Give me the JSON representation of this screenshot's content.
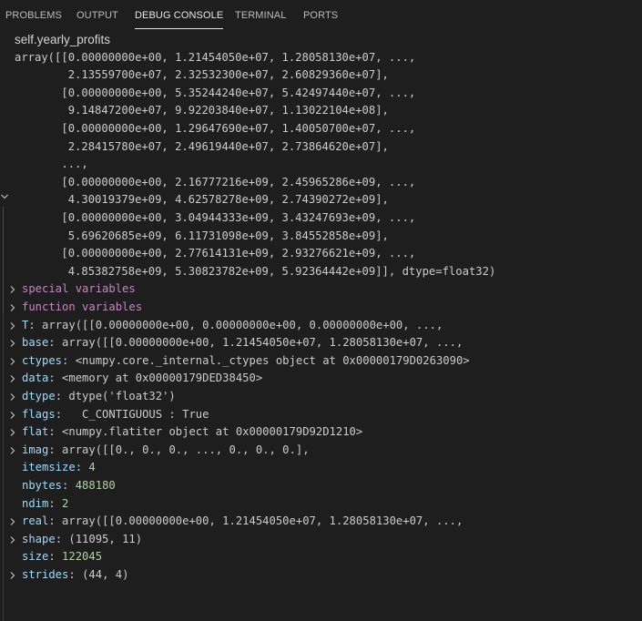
{
  "tabs": [
    {
      "label": "PROBLEMS",
      "active": false
    },
    {
      "label": "OUTPUT",
      "active": false
    },
    {
      "label": "DEBUG CONSOLE",
      "active": true
    },
    {
      "label": "TERMINAL",
      "active": false
    },
    {
      "label": "PORTS",
      "active": false
    }
  ],
  "console": {
    "expression": "self.yearly_profits",
    "array_lines": [
      "array([[0.00000000e+00, 1.21454050e+07, 1.28058130e+07, ...,",
      "        2.13559700e+07, 2.32532300e+07, 2.60829360e+07],",
      "       [0.00000000e+00, 5.35244240e+07, 5.42497440e+07, ...,",
      "        9.14847200e+07, 9.92203840e+07, 1.13022104e+08],",
      "       [0.00000000e+00, 1.29647690e+07, 1.40050700e+07, ...,",
      "        2.28415780e+07, 2.49619440e+07, 2.73864620e+07],",
      "       ...,",
      "       [0.00000000e+00, 2.16777216e+09, 2.45965286e+09, ...,",
      "        4.30019379e+09, 4.62578278e+09, 2.74390272e+09],",
      "       [0.00000000e+00, 3.04944333e+09, 3.43247693e+09, ...,",
      "        5.69620685e+09, 6.11731098e+09, 3.84552858e+09],",
      "       [0.00000000e+00, 2.77614131e+09, 2.93276621e+09, ...,",
      "        4.85382758e+09, 5.30823782e+09, 5.92364442e+09]], dtype=float32)"
    ],
    "properties": [
      {
        "key": "special variables",
        "value": "",
        "expandable": true,
        "group": true
      },
      {
        "key": "function variables",
        "value": "",
        "expandable": true,
        "group": true
      },
      {
        "key": "T",
        "value": "array([[0.00000000e+00, 0.00000000e+00, 0.00000000e+00, ...,",
        "expandable": true
      },
      {
        "key": "base",
        "value": "array([[0.00000000e+00, 1.21454050e+07, 1.28058130e+07, ...,",
        "expandable": true
      },
      {
        "key": "ctypes",
        "value": "<numpy.core._internal._ctypes object at 0x00000179D0263090>",
        "expandable": true
      },
      {
        "key": "data",
        "value": "<memory at 0x00000179DED38450>",
        "expandable": true
      },
      {
        "key": "dtype",
        "value": "dtype('float32')",
        "expandable": true
      },
      {
        "key": "flags",
        "value": "  C_CONTIGUOUS : True",
        "expandable": true
      },
      {
        "key": "flat",
        "value": "<numpy.flatiter object at 0x00000179D92D1210>",
        "expandable": true
      },
      {
        "key": "imag",
        "value": "array([[0., 0., 0., ..., 0., 0., 0.],",
        "expandable": true
      },
      {
        "key": "itemsize",
        "value": "4",
        "expandable": false,
        "numeric": true
      },
      {
        "key": "nbytes",
        "value": "488180",
        "expandable": false,
        "numeric": true
      },
      {
        "key": "ndim",
        "value": "2",
        "expandable": false,
        "numeric": true
      },
      {
        "key": "real",
        "value": "array([[0.00000000e+00, 1.21454050e+07, 1.28058130e+07, ...,",
        "expandable": true
      },
      {
        "key": "shape",
        "value": "(11095, 11)",
        "expandable": true
      },
      {
        "key": "size",
        "value": "122045",
        "expandable": false,
        "numeric": true
      },
      {
        "key": "strides",
        "value": "(44, 4)",
        "expandable": true
      }
    ]
  },
  "icons": {
    "expand": "chevron-right-icon",
    "collapse": "chevron-down-icon"
  },
  "colors": {
    "background": "#1e1e1e",
    "text": "#cccccc",
    "key": "#9cdcfe",
    "number": "#b5cea8"
  }
}
